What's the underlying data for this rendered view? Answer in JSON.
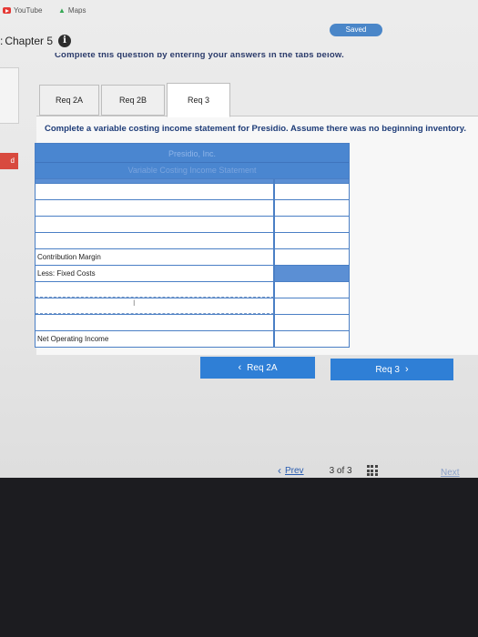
{
  "bookmarks": {
    "youtube": "YouTube",
    "maps": "Maps"
  },
  "header": {
    "saved_label": "Saved",
    "chapter_colon": ":",
    "chapter": "Chapter 5",
    "info_icon": "i",
    "instruction": "Complete this question by entering your answers in the tabs below."
  },
  "sidebar": {
    "left_tab_label": "d"
  },
  "tabs": [
    {
      "label": "Req 2A"
    },
    {
      "label": "Req 2B"
    },
    {
      "label": "Req 3"
    }
  ],
  "active_tab": "Req 3",
  "question": {
    "text": "Complete a variable costing income statement for Presidio. Assume there was no beginning inventory."
  },
  "statement": {
    "company": "Presidio, Inc.",
    "title": "Variable Costing Income Statement",
    "rows": [
      {
        "label": "",
        "amount": ""
      },
      {
        "label": "",
        "amount": ""
      },
      {
        "label": "",
        "amount": ""
      },
      {
        "label": "",
        "amount": ""
      },
      {
        "label": "Contribution Margin",
        "amount": ""
      },
      {
        "label": "Less: Fixed Costs",
        "amount": ""
      },
      {
        "label": "",
        "amount": ""
      },
      {
        "label": "",
        "amount": ""
      },
      {
        "label": "",
        "amount": ""
      },
      {
        "label": "Net Operating Income",
        "amount": ""
      }
    ]
  },
  "navigation": {
    "prev_req_label": "Req 2A",
    "next_req_label": "Req 3",
    "prev_label": "Prev",
    "page_current": "3",
    "page_of": "of",
    "page_total": "3",
    "next_label": "Next"
  },
  "colors": {
    "accent_blue": "#2f7fd6",
    "table_blue": "#4a86d0",
    "saved_badge": "#4a86c8",
    "red_tab": "#d84a3f"
  }
}
